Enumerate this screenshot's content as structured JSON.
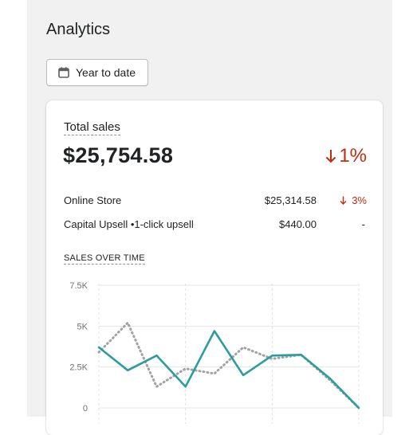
{
  "page": {
    "title": "Analytics"
  },
  "date_range": {
    "label": "Year to date",
    "icon": "calendar-icon"
  },
  "card": {
    "metric_title": "Total sales",
    "metric_value": "$25,754.58",
    "metric_change": "1%",
    "metric_change_direction": "down",
    "negative_color": "#bf2c0f",
    "breakdown": [
      {
        "name": "Online Store",
        "amount": "$25,314.58",
        "change": "3%",
        "direction": "down"
      },
      {
        "name": "Capital Upsell •1-click upsell",
        "amount": "$440.00",
        "change": "-",
        "direction": "none"
      }
    ],
    "chart_title": "SALES OVER TIME"
  },
  "chart_data": {
    "type": "line",
    "title": "SALES OVER TIME",
    "y_ticks": [
      "7.5K",
      "5K",
      "2.5K",
      "0"
    ],
    "ylim": [
      0,
      7500
    ],
    "grid": true,
    "series": [
      {
        "style": "solid",
        "color": "#2c9d9d",
        "values": [
          3700,
          2300,
          3200,
          1300,
          4700,
          2000,
          3200,
          3250,
          1800,
          0
        ]
      },
      {
        "style": "dotted",
        "color": "#a0a3a6",
        "values": [
          3400,
          5200,
          1300,
          2400,
          2100,
          3700,
          3000,
          3250,
          1700,
          0
        ]
      }
    ]
  }
}
